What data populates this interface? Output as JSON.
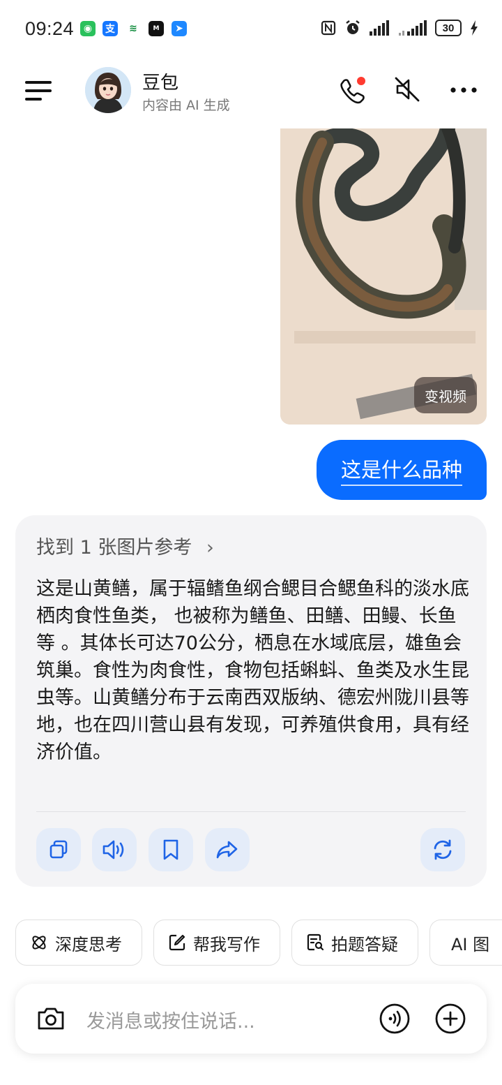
{
  "status_bar": {
    "time": "09:24",
    "battery": "30"
  },
  "header": {
    "title": "豆包",
    "subtitle": "内容由 AI 生成"
  },
  "photo": {
    "video_label": "变视频"
  },
  "user_message": {
    "text": "这是什么品种"
  },
  "answer": {
    "reference": "找到 1 张图片参考",
    "text": "这是山黄鳝，属于辐鳍鱼纲合鳃目合鳃鱼科的淡水底栖肉食性鱼类， 也被称为鳝鱼、田鳝、田鳗、长鱼等 。其体长可达70公分，栖息在水域底层，雄鱼会筑巢。食性为肉食性，食物包括蝌蚪、鱼类及水生昆虫等。山黄鳝分布于云南西双版纳、德宏州陇川县等地，也在四川营山县有发现，可养殖供食用，具有经济价值。"
  },
  "chips": [
    {
      "label": "深度思考",
      "icon": "atom-icon"
    },
    {
      "label": "帮我写作",
      "icon": "edit-icon"
    },
    {
      "label": "拍题答疑",
      "icon": "search-doc-icon"
    },
    {
      "label": "AI 图",
      "icon": "sparkle-icon"
    }
  ],
  "input": {
    "placeholder": "发消息或按住说话..."
  },
  "colors": {
    "accent": "#0a6cff",
    "card_bg": "#f4f4f6",
    "action_bg": "#e4ecf9"
  }
}
